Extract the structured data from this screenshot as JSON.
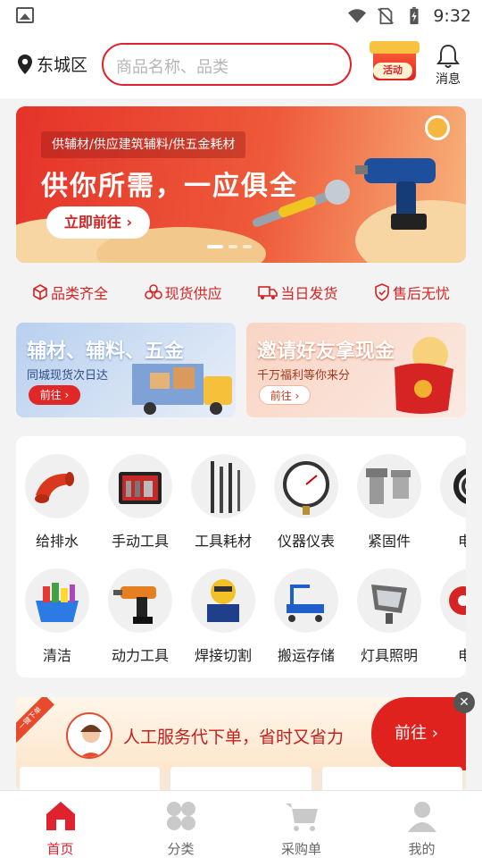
{
  "status_bar": {
    "time": "9:32"
  },
  "header": {
    "location": "东城区",
    "search_placeholder": "商品名称、品类",
    "promo_label": "活动",
    "message_label": "消息"
  },
  "hero_banner": {
    "subtitle": "供辅材/供应建筑辅料/供五金耗材",
    "title": "供你所需，一应俱全",
    "button": "立即前往 ›"
  },
  "features": [
    {
      "label": "品类齐全",
      "icon": "box-icon"
    },
    {
      "label": "现货供应",
      "icon": "stack-icon"
    },
    {
      "label": "当日发货",
      "icon": "truck-icon"
    },
    {
      "label": "售后无忧",
      "icon": "shield-icon"
    }
  ],
  "promo_cards": [
    {
      "title": "辅材、辅料、五金",
      "subtitle": "同城现货次日达",
      "button": "前往 ›"
    },
    {
      "title": "邀请好友拿现金",
      "subtitle": "千万福利等你来分",
      "button": "前往 ›"
    }
  ],
  "categories": [
    {
      "label": "给排水",
      "icon": "pipe-elbow-icon"
    },
    {
      "label": "手动工具",
      "icon": "toolbox-icon"
    },
    {
      "label": "工具耗材",
      "icon": "drill-bits-icon"
    },
    {
      "label": "仪器仪表",
      "icon": "gauge-icon"
    },
    {
      "label": "紧固件",
      "icon": "bolt-icon"
    },
    {
      "label": "电力",
      "icon": "cable-icon"
    },
    {
      "label": "清洁",
      "icon": "cleaning-basket-icon"
    },
    {
      "label": "动力工具",
      "icon": "power-drill-icon"
    },
    {
      "label": "焊接切割",
      "icon": "cutter-icon"
    },
    {
      "label": "搬运存储",
      "icon": "cart-icon"
    },
    {
      "label": "灯具照明",
      "icon": "floodlight-icon"
    },
    {
      "label": "电工",
      "icon": "tape-icon"
    }
  ],
  "service_banner": {
    "ribbon": "一键下单",
    "text": "人工服务代下单，省时又省力",
    "button": "前往 ›",
    "close": "✕"
  },
  "bottom_nav": [
    {
      "label": "首页",
      "icon": "home-icon",
      "active": true
    },
    {
      "label": "分类",
      "icon": "category-icon",
      "active": false
    },
    {
      "label": "采购单",
      "icon": "cart-icon",
      "active": false
    },
    {
      "label": "我的",
      "icon": "profile-icon",
      "active": false
    }
  ],
  "colors": {
    "primary": "#e0212e",
    "background": "#f3f3f3"
  }
}
